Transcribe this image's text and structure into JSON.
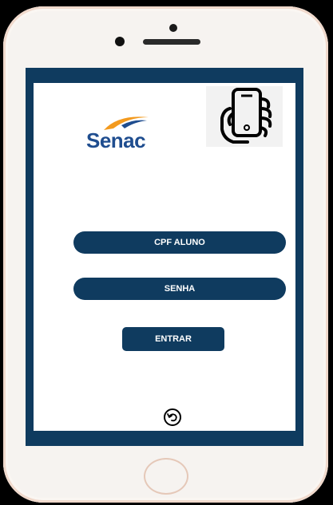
{
  "brand": {
    "logo_text": "Senac"
  },
  "login": {
    "cpf_label": "CPF ALUNO",
    "password_label": "SENHA",
    "submit_label": "ENTRAR"
  },
  "icons": {
    "back": "undo-arrow-icon",
    "hand_phone": "hand-holding-phone-icon"
  },
  "colors": {
    "primary": "#0f3b5f",
    "brand_blue": "#1f4d8f",
    "brand_orange": "#f39a1e",
    "phone_body": "#f6f3f0"
  }
}
